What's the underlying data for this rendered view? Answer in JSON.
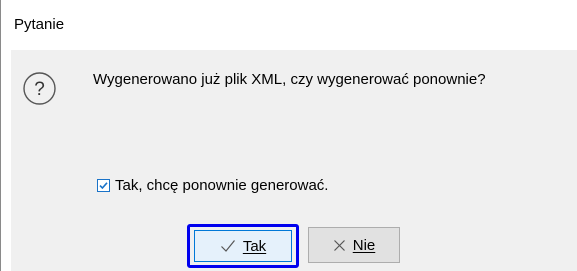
{
  "window": {
    "title": "Pytanie"
  },
  "icons": {
    "question": "question-mark-circle-icon",
    "checkmark": "checkmark-icon",
    "cross": "cross-icon"
  },
  "message": "Wygenerowano już plik XML, czy wygenerować ponownie?",
  "checkbox": {
    "label": "Tak, chcę ponownie generować.",
    "checked": true
  },
  "buttons": {
    "yes_label": "Tak",
    "no_label": "Nie"
  },
  "colors": {
    "focus_ring": "#0000ee",
    "checkbox_accent": "#1a73c8",
    "client_background": "#f0f0f0"
  }
}
